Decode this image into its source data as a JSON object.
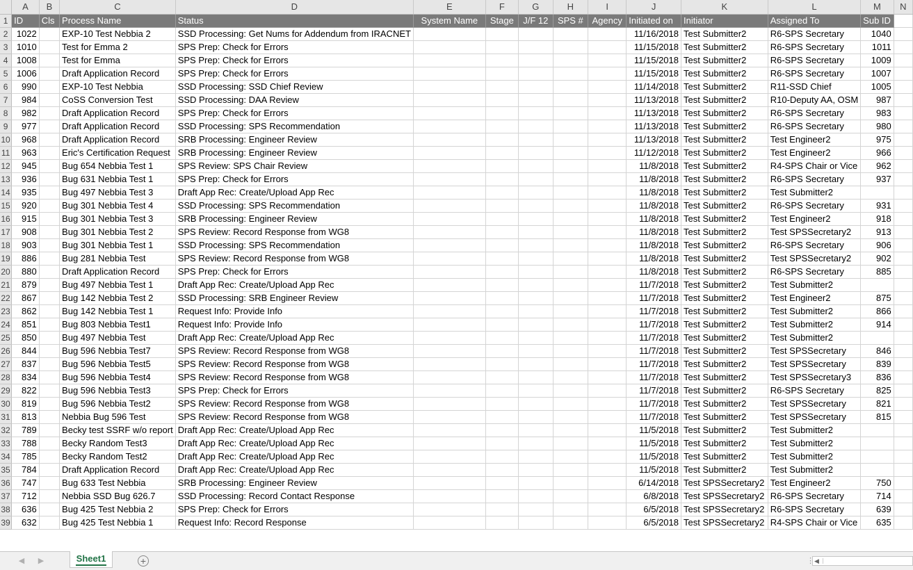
{
  "columns": [
    "A",
    "B",
    "C",
    "D",
    "E",
    "F",
    "G",
    "H",
    "I",
    "J",
    "K",
    "L",
    "M",
    "N"
  ],
  "headers": {
    "A": "ID",
    "B": "Cls",
    "C": "Process Name",
    "D": "Status",
    "E": "System Name",
    "F": "Stage",
    "G": "J/F 12",
    "H": "SPS #",
    "I": "Agency",
    "J": "Initiated on",
    "K": "Initiator",
    "L": "Assigned To",
    "M": "Sub ID"
  },
  "rows": [
    {
      "row": "2",
      "id": "1022",
      "process": "EXP-10 Test Nebbia 2",
      "status": "SSD Processing: Get Nums for Addendum from IRACNET",
      "date": "11/16/2018",
      "initiator": "Test Submitter2",
      "assigned": "R6-SPS Secretary",
      "subid": "1040"
    },
    {
      "row": "3",
      "id": "1010",
      "process": "Test for Emma 2",
      "status": "SPS Prep: Check for Errors",
      "date": "11/15/2018",
      "initiator": "Test Submitter2",
      "assigned": "R6-SPS Secretary",
      "subid": "1011"
    },
    {
      "row": "4",
      "id": "1008",
      "process": "Test for Emma",
      "status": "SPS Prep: Check for Errors",
      "date": "11/15/2018",
      "initiator": "Test Submitter2",
      "assigned": "R6-SPS Secretary",
      "subid": "1009"
    },
    {
      "row": "5",
      "id": "1006",
      "process": "Draft Application Record",
      "status": "SPS Prep: Check for Errors",
      "date": "11/15/2018",
      "initiator": "Test Submitter2",
      "assigned": "R6-SPS Secretary",
      "subid": "1007"
    },
    {
      "row": "6",
      "id": "990",
      "process": "EXP-10 Test Nebbia",
      "status": "SSD Processing: SSD Chief Review",
      "date": "11/14/2018",
      "initiator": "Test Submitter2",
      "assigned": "R11-SSD Chief",
      "subid": "1005"
    },
    {
      "row": "7",
      "id": "984",
      "process": "CoSS Conversion Test",
      "status": "SSD Processing: DAA Review",
      "date": "11/13/2018",
      "initiator": "Test Submitter2",
      "assigned": "R10-Deputy AA, OSM",
      "subid": "987"
    },
    {
      "row": "8",
      "id": "982",
      "process": "Draft Application Record",
      "status": "SPS Prep: Check for Errors",
      "date": "11/13/2018",
      "initiator": "Test Submitter2",
      "assigned": "R6-SPS Secretary",
      "subid": "983"
    },
    {
      "row": "9",
      "id": "977",
      "process": "Draft Application Record",
      "status": "SSD Processing: SPS Recommendation",
      "date": "11/13/2018",
      "initiator": "Test Submitter2",
      "assigned": "R6-SPS Secretary",
      "subid": "980"
    },
    {
      "row": "10",
      "id": "968",
      "process": "Draft Application Record",
      "status": "SRB Processing: Engineer Review",
      "date": "11/13/2018",
      "initiator": "Test Submitter2",
      "assigned": "Test Engineer2",
      "subid": "975"
    },
    {
      "row": "11",
      "id": "963",
      "process": "Eric's Certification Request",
      "status": "SRB Processing: Engineer Review",
      "date": "11/12/2018",
      "initiator": "Test Submitter2",
      "assigned": "Test Engineer2",
      "subid": "966"
    },
    {
      "row": "12",
      "id": "945",
      "process": "Bug 654 Nebbia Test 1",
      "status": "SPS Review: SPS Chair Review",
      "date": "11/8/2018",
      "initiator": "Test Submitter2",
      "assigned": "R4-SPS Chair or Vice",
      "subid": "962"
    },
    {
      "row": "13",
      "id": "936",
      "process": "Bug 631 Nebbia Test 1",
      "status": "SPS Prep: Check for Errors",
      "date": "11/8/2018",
      "initiator": "Test Submitter2",
      "assigned": "R6-SPS Secretary",
      "subid": "937"
    },
    {
      "row": "14",
      "id": "935",
      "process": "Bug 497 Nebbia Test 3",
      "status": "Draft App Rec: Create/Upload App Rec",
      "date": "11/8/2018",
      "initiator": "Test Submitter2",
      "assigned": "Test Submitter2",
      "subid": ""
    },
    {
      "row": "15",
      "id": "920",
      "process": "Bug 301 Nebbia Test 4",
      "status": "SSD Processing: SPS Recommendation",
      "date": "11/8/2018",
      "initiator": "Test Submitter2",
      "assigned": "R6-SPS Secretary",
      "subid": "931"
    },
    {
      "row": "16",
      "id": "915",
      "process": "Bug 301 Nebbia Test 3",
      "status": "SRB Processing: Engineer Review",
      "date": "11/8/2018",
      "initiator": "Test Submitter2",
      "assigned": "Test Engineer2",
      "subid": "918"
    },
    {
      "row": "17",
      "id": "908",
      "process": "Bug 301 Nebbia Test 2",
      "status": "SPS Review: Record Response from WG8",
      "date": "11/8/2018",
      "initiator": "Test Submitter2",
      "assigned": "Test SPSSecretary2",
      "subid": "913"
    },
    {
      "row": "18",
      "id": "903",
      "process": "Bug 301 Nebbia Test 1",
      "status": "SSD Processing: SPS Recommendation",
      "date": "11/8/2018",
      "initiator": "Test Submitter2",
      "assigned": "R6-SPS Secretary",
      "subid": "906"
    },
    {
      "row": "19",
      "id": "886",
      "process": "Bug 281 Nebbia Test",
      "status": "SPS Review: Record Response from WG8",
      "date": "11/8/2018",
      "initiator": "Test Submitter2",
      "assigned": "Test SPSSecretary2",
      "subid": "902"
    },
    {
      "row": "20",
      "id": "880",
      "process": "Draft Application Record",
      "status": "SPS Prep: Check for Errors",
      "date": "11/8/2018",
      "initiator": "Test Submitter2",
      "assigned": "R6-SPS Secretary",
      "subid": "885"
    },
    {
      "row": "21",
      "id": "879",
      "process": "Bug 497 Nebbia Test 1",
      "status": "Draft App Rec: Create/Upload App Rec",
      "date": "11/7/2018",
      "initiator": "Test Submitter2",
      "assigned": "Test Submitter2",
      "subid": ""
    },
    {
      "row": "22",
      "id": "867",
      "process": "Bug 142 Nebbia Test 2",
      "status": "SSD Processing: SRB Engineer Review",
      "date": "11/7/2018",
      "initiator": "Test Submitter2",
      "assigned": "Test Engineer2",
      "subid": "875"
    },
    {
      "row": "23",
      "id": "862",
      "process": "Bug 142 Nebbia Test 1",
      "status": "Request Info: Provide Info",
      "date": "11/7/2018",
      "initiator": "Test Submitter2",
      "assigned": "Test Submitter2",
      "subid": "866"
    },
    {
      "row": "24",
      "id": "851",
      "process": "Bug 803 Nebbia Test1",
      "status": "Request Info: Provide Info",
      "date": "11/7/2018",
      "initiator": "Test Submitter2",
      "assigned": "Test Submitter2",
      "subid": "914"
    },
    {
      "row": "25",
      "id": "850",
      "process": "Bug 497 Nebbia Test",
      "status": "Draft App Rec: Create/Upload App Rec",
      "date": "11/7/2018",
      "initiator": "Test Submitter2",
      "assigned": "Test Submitter2",
      "subid": ""
    },
    {
      "row": "26",
      "id": "844",
      "process": "Bug 596 Nebbia Test7",
      "status": "SPS Review: Record Response from WG8",
      "date": "11/7/2018",
      "initiator": "Test Submitter2",
      "assigned": "Test SPSSecretary",
      "subid": "846"
    },
    {
      "row": "27",
      "id": "837",
      "process": "Bug 596 Nebbia Test5",
      "status": "SPS Review: Record Response from WG8",
      "date": "11/7/2018",
      "initiator": "Test Submitter2",
      "assigned": "Test SPSSecretary",
      "subid": "839"
    },
    {
      "row": "28",
      "id": "834",
      "process": "Bug 596 Nebbia Test4",
      "status": "SPS Review: Record Response from WG8",
      "date": "11/7/2018",
      "initiator": "Test Submitter2",
      "assigned": "Test SPSSecretary3",
      "subid": "836"
    },
    {
      "row": "29",
      "id": "822",
      "process": "Bug 596 Nebbia Test3",
      "status": "SPS Prep: Check for Errors",
      "date": "11/7/2018",
      "initiator": "Test Submitter2",
      "assigned": "R6-SPS Secretary",
      "subid": "825"
    },
    {
      "row": "30",
      "id": "819",
      "process": "Bug 596 Nebbia Test2",
      "status": "SPS Review: Record Response from WG8",
      "date": "11/7/2018",
      "initiator": "Test Submitter2",
      "assigned": "Test SPSSecretary",
      "subid": "821"
    },
    {
      "row": "31",
      "id": "813",
      "process": "Nebbia Bug 596 Test",
      "status": "SPS Review: Record Response from WG8",
      "date": "11/7/2018",
      "initiator": "Test Submitter2",
      "assigned": "Test SPSSecretary",
      "subid": "815"
    },
    {
      "row": "32",
      "id": "789",
      "process": "Becky test SSRF w/o report",
      "status": "Draft App Rec: Create/Upload App Rec",
      "date": "11/5/2018",
      "initiator": "Test Submitter2",
      "assigned": "Test Submitter2",
      "subid": ""
    },
    {
      "row": "33",
      "id": "788",
      "process": "Becky Random Test3",
      "status": "Draft App Rec: Create/Upload App Rec",
      "date": "11/5/2018",
      "initiator": "Test Submitter2",
      "assigned": "Test Submitter2",
      "subid": ""
    },
    {
      "row": "34",
      "id": "785",
      "process": "Becky Random Test2",
      "status": "Draft App Rec: Create/Upload App Rec",
      "date": "11/5/2018",
      "initiator": "Test Submitter2",
      "assigned": "Test Submitter2",
      "subid": ""
    },
    {
      "row": "35",
      "id": "784",
      "process": "Draft Application Record",
      "status": "Draft App Rec: Create/Upload App Rec",
      "date": "11/5/2018",
      "initiator": "Test Submitter2",
      "assigned": "Test Submitter2",
      "subid": ""
    },
    {
      "row": "36",
      "id": "747",
      "process": "Bug 633 Test Nebbia",
      "status": "SRB Processing: Engineer Review",
      "date": "6/14/2018",
      "initiator": "Test SPSSecretary2",
      "assigned": "Test Engineer2",
      "subid": "750"
    },
    {
      "row": "37",
      "id": "712",
      "process": "Nebbia SSD Bug 626.7",
      "status": "SSD Processing: Record Contact Response",
      "date": "6/8/2018",
      "initiator": "Test SPSSecretary2",
      "assigned": "R6-SPS Secretary",
      "subid": "714"
    },
    {
      "row": "38",
      "id": "636",
      "process": "Bug 425 Test Nebbia 2",
      "status": "SPS Prep: Check for Errors",
      "date": "6/5/2018",
      "initiator": "Test SPSSecretary2",
      "assigned": "R6-SPS Secretary",
      "subid": "639"
    },
    {
      "row": "39",
      "id": "632",
      "process": "Bug 425 Test Nebbia 1",
      "status": "Request Info: Record Response",
      "date": "6/5/2018",
      "initiator": "Test SPSSecretary2",
      "assigned": "R4-SPS Chair or Vice",
      "subid": "635"
    }
  ],
  "sheet_tab": "Sheet1",
  "icons": {
    "add_sheet": "plus-circle-icon",
    "nav_prev": "triangle-left-icon",
    "nav_next": "triangle-right-icon"
  },
  "colors": {
    "header_fill": "#7a7a7a",
    "sheet_tab_text": "#217346"
  }
}
